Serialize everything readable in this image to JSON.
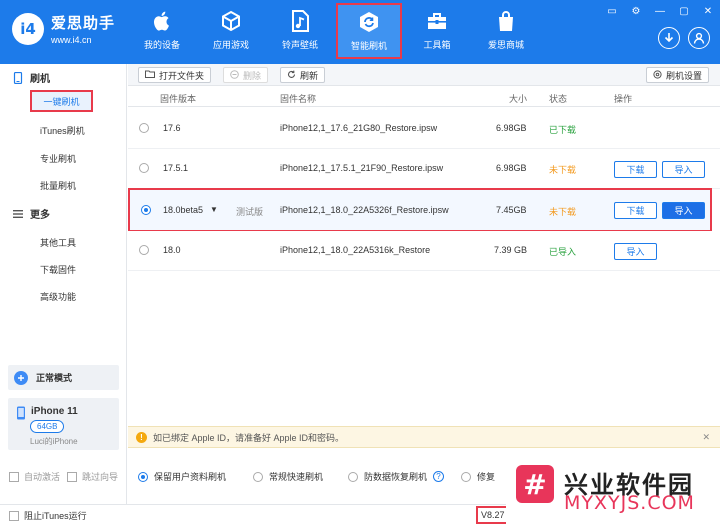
{
  "app": {
    "logo_mark": "i4",
    "name": "爱思助手",
    "url": "www.i4.cn"
  },
  "nav": [
    {
      "label": "我的设备",
      "icon": "apple-icon"
    },
    {
      "label": "应用游戏",
      "icon": "cube-icon"
    },
    {
      "label": "铃声壁纸",
      "icon": "music-file-icon"
    },
    {
      "label": "智能刷机",
      "icon": "refresh-shield-icon",
      "active": true
    },
    {
      "label": "工具箱",
      "icon": "toolbox-icon"
    },
    {
      "label": "爱思商城",
      "icon": "shopping-bag-icon"
    }
  ],
  "window_controls": [
    "▭",
    "⚙",
    "—",
    "▢",
    "✕"
  ],
  "sidebar": {
    "section_flash": "刷机",
    "flash_items": [
      "一键刷机",
      "iTunes刷机",
      "专业刷机",
      "批量刷机"
    ],
    "section_more": "更多",
    "more_items": [
      "其他工具",
      "下载固件",
      "高级功能"
    ],
    "mode_label": "正常模式",
    "device_name": "iPhone 11",
    "device_storage": "64GB",
    "device_owner": "Luci的iPhone",
    "auto_activate": "自动激活",
    "skip_guide": "跳过向导",
    "block_itunes": "阻止iTunes运行"
  },
  "toolbar": {
    "open_folder": "打开文件夹",
    "delete": "删除",
    "refresh": "刷新",
    "flash_settings": "刷机设置"
  },
  "table": {
    "headers": {
      "version": "固件版本",
      "name": "固件名称",
      "size": "大小",
      "status": "状态",
      "action": "操作"
    },
    "rows": [
      {
        "version": "17.6",
        "tag": "",
        "name": "iPhone12,1_17.6_21G80_Restore.ipsw",
        "size": "6.98GB",
        "status": "已下载",
        "status_color": "#2aa23f",
        "btn_download": "",
        "btn_import": ""
      },
      {
        "version": "17.5.1",
        "tag": "",
        "name": "iPhone12,1_17.5.1_21F90_Restore.ipsw",
        "size": "6.98GB",
        "status": "未下载",
        "status_color": "#f39a1f",
        "btn_download": "下载",
        "btn_import": "导入"
      },
      {
        "version": "18.0beta5",
        "tag": "测试版",
        "name": "iPhone12,1_18.0_22A5326f_Restore.ipsw",
        "size": "7.45GB",
        "status": "未下载",
        "status_color": "#f39a1f",
        "btn_download": "下载",
        "btn_import": "导入"
      },
      {
        "version": "18.0",
        "tag": "",
        "name": "iPhone12,1_18.0_22A5316k_Restore",
        "size": "7.39 GB",
        "status": "已导入",
        "status_color": "#2aa23f",
        "btn_download": "",
        "btn_import": "导入"
      }
    ]
  },
  "notice": {
    "text": "如已绑定 Apple ID，请准备好 Apple ID和密码。",
    "close": "✕"
  },
  "options": {
    "keep_data": "保留用户资料刷机",
    "quick": "常规快速刷机",
    "anti_recovery": "防数据恢复刷机",
    "repair": "修复"
  },
  "status": {
    "version": "V8.27"
  },
  "watermark": {
    "mark": "#",
    "title": "兴业软件园",
    "url": "MYXYJS.COM"
  }
}
